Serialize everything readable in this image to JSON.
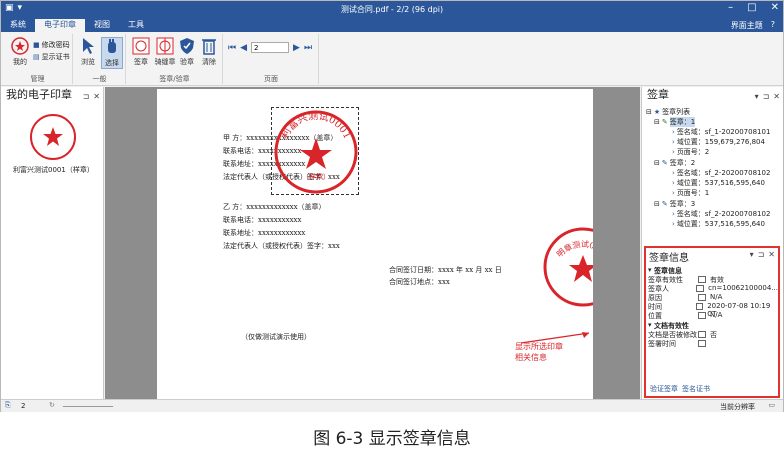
{
  "window": {
    "title": "测试合同.pdf - 2/2 (96 dpi)"
  },
  "ribbon_tabs": [
    "系统",
    "电子印章",
    "视图",
    "工具"
  ],
  "ribbon_right": {
    "theme": "界面主题"
  },
  "ribbon": {
    "management": {
      "label": "管理",
      "my_label": "我的",
      "modify_password": "修改密码",
      "show_cert": "显示证书"
    },
    "general": {
      "label": "一般",
      "browse": "浏览",
      "select": "选择"
    },
    "sign": {
      "label": "签章/验章",
      "sign": "签章",
      "riding_seal": "骑缝章",
      "verify": "验章",
      "clear": "清除"
    },
    "page": {
      "label": "页面",
      "current": "2"
    }
  },
  "left_panel": {
    "title": "我的电子印章",
    "seal_caption": "利富兴测试0001（样章）",
    "seal_text": "利富兴测试0001",
    "seal_sub": "（样章）"
  },
  "document": {
    "party_a": [
      "甲    方：xxxxxxxxxxxxxxxx（盖章）",
      "联系电话：xxxxxxxxxxx",
      "联系地址：xxxxxxxxxxxx",
      "法定代表人（或授权代表）签字：xxx"
    ],
    "party_b": [
      "乙    方：xxxxxxxxxxxxx（盖章）",
      "联系电话：xxxxxxxxxxx",
      "联系地址：xxxxxxxxxxxx",
      "法定代表人（或授权代表）签字：xxx"
    ],
    "sign_date": "合同签订日期：xxxx 年 xx 月 xx 日",
    "sign_place": "合同签订地点：xxx",
    "demo_note": "（仅做测试演示使用）",
    "seal_text": "利富兴测试0001",
    "seal_sub": "（样章）",
    "riding_seal_text": "明章测试0001"
  },
  "annotation": {
    "line1": "显示所选印章",
    "line2": "相关信息"
  },
  "signature_panel": {
    "title": "签章",
    "list_label": "签章列表",
    "items": [
      {
        "label": "签章：1",
        "name": "签名域：sf_1-20200708101",
        "position": "域位置：159,679,276,804",
        "page": "页面号：2"
      },
      {
        "label": "签章：2",
        "name": "签名域：sf_2-20200708102",
        "position": "域位置：537,516,595,640",
        "page": "页面号：1"
      },
      {
        "label": "签章：3",
        "name": "签名域：sf_2-20200708102",
        "position": "域位置：537,516,595,640"
      }
    ]
  },
  "info_panel": {
    "title": "签章信息",
    "section1": "签章信息",
    "rows1": [
      {
        "k": "签章有效性",
        "v": "有效"
      },
      {
        "k": "签章人",
        "v": "cn=10062100004..."
      },
      {
        "k": "原因",
        "v": "N/A"
      },
      {
        "k": "时间",
        "v": "2020-07-08 10:19 CT"
      },
      {
        "k": "位置",
        "v": "N/A"
      }
    ],
    "section2": "文档有效性",
    "rows2": [
      {
        "k": "文档是否被修改",
        "v": "否"
      },
      {
        "k": "签署时间",
        "v": ""
      }
    ],
    "link1": "验证签章",
    "link2": "签名证书"
  },
  "statusbar": {
    "page": "2",
    "resolution": "当前分辨率"
  },
  "caption": "图  6-3 显示签章信息",
  "colors": {
    "titlebar": "#2b579a",
    "seal": "#d9252a",
    "highlight": "#e0332e"
  }
}
